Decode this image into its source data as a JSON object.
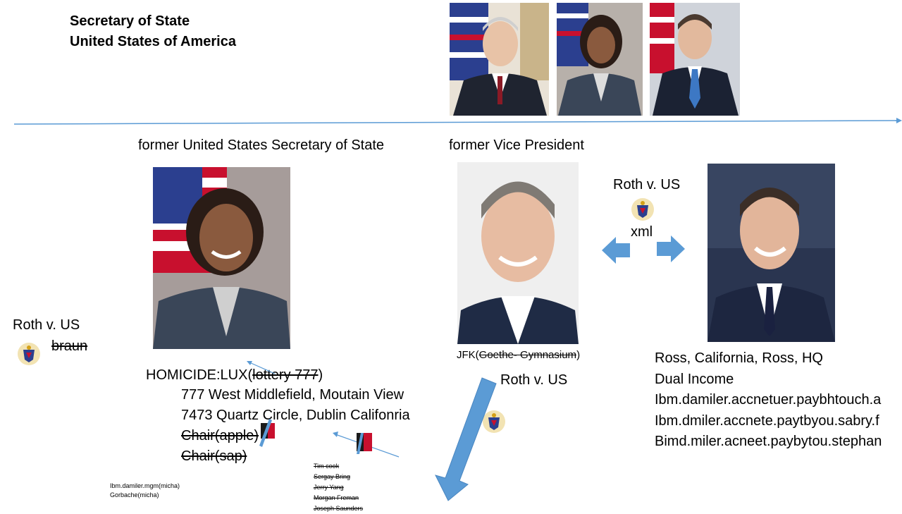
{
  "header": {
    "line1": "Secretary of State",
    "line2": "United States of America"
  },
  "captions": {
    "former_secretary": "former United States Secretary of State",
    "former_vp": "former Vice President"
  },
  "roth_labels": {
    "left": "Roth v. US",
    "center": "Roth v. US",
    "right": "Roth v. US"
  },
  "xml_label": "xml",
  "braun": "braun",
  "homicide": {
    "prefix": "HOMICIDE:LUX(",
    "struck": "lottery 777",
    "suffix": ")"
  },
  "addresses": [
    "777 West Middlefield, Moutain View",
    "7473 Quartz Circle, Dublin Califonria"
  ],
  "chairs": [
    "Chair(apple)",
    "Chair(sap)"
  ],
  "jfk": {
    "prefix": "JFK(",
    "struck": "Goethe- Gymnasium",
    "suffix": ")"
  },
  "right_block": [
    "Ross, California, Ross, HQ",
    "Dual Income",
    "Ibm.damiler.accnetuer.paybhtouch.a",
    "Ibm.dmiler.accnete.paytbyou.sabry.f",
    "Bimd.miler.acneet.paybytou.stephan"
  ],
  "small_left": [
    "Ibm.damiler.mgm(micha)",
    "Gorbache(micha)"
  ],
  "struck_names": [
    "Tim cook",
    "Sergay Bring",
    "Jerry Yang",
    "Morgan Freman",
    "Joseph Saunders"
  ],
  "colors": {
    "arrow_blue": "#5b9bd5",
    "line_blue": "#5b9bd5",
    "flag_red": "#c8102e",
    "flag_blue": "#2b3f8f"
  }
}
